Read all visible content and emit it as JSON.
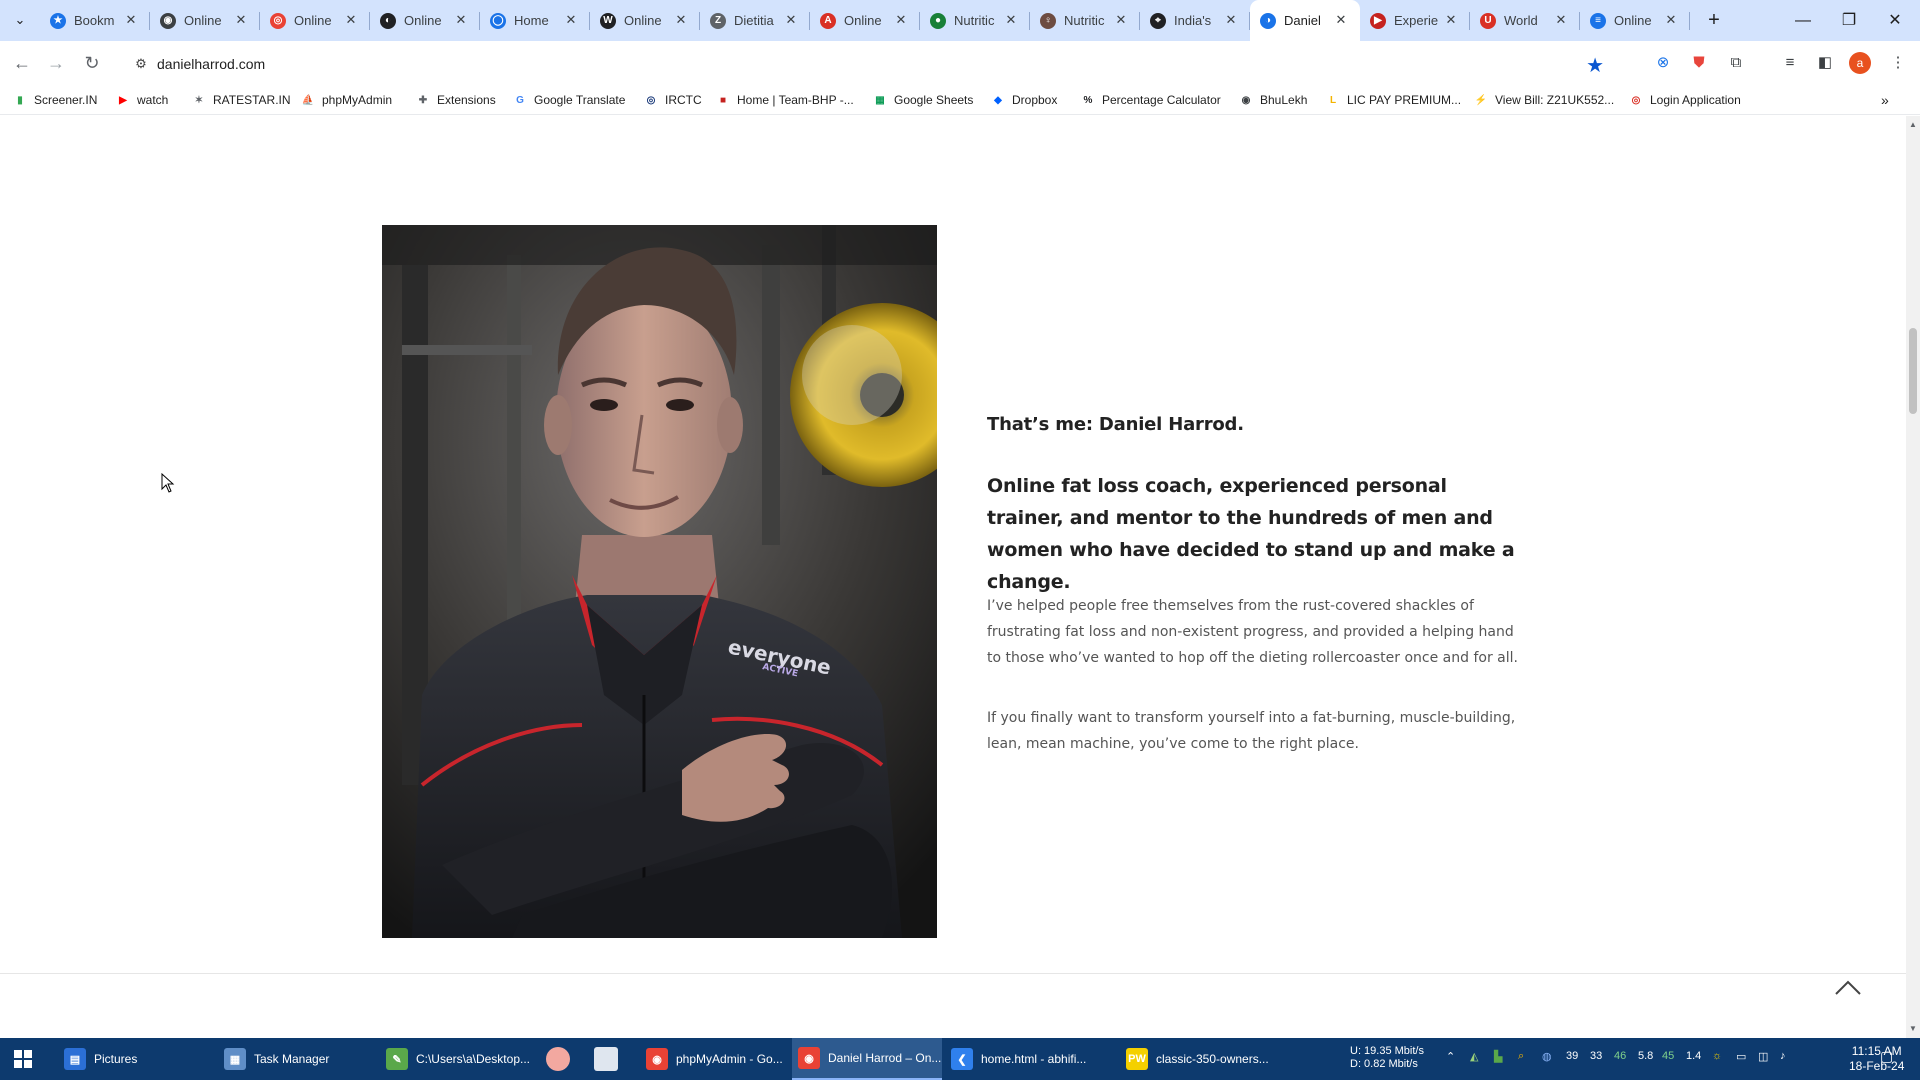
{
  "browser": {
    "tabs": [
      {
        "title": "Bookm",
        "fav_color": "#1a73e8",
        "fav_glyph": "★"
      },
      {
        "title": "Online",
        "fav_color": "#3c4043",
        "fav_glyph": "◉"
      },
      {
        "title": "Online",
        "fav_color": "#e94235",
        "fav_glyph": "◎"
      },
      {
        "title": "Online",
        "fav_color": "#202124",
        "fav_glyph": "◐"
      },
      {
        "title": "Home",
        "fav_color": "#1a73e8",
        "fav_glyph": "◯"
      },
      {
        "title": "Online",
        "fav_color": "#202124",
        "fav_glyph": "W"
      },
      {
        "title": "Dietitia",
        "fav_color": "#5f6368",
        "fav_glyph": "Z"
      },
      {
        "title": "Online",
        "fav_color": "#d93025",
        "fav_glyph": "A"
      },
      {
        "title": "Nutritic",
        "fav_color": "#188038",
        "fav_glyph": "●"
      },
      {
        "title": "Nutritic",
        "fav_color": "#6d4c41",
        "fav_glyph": "♀"
      },
      {
        "title": "India's",
        "fav_color": "#202124",
        "fav_glyph": "⌖"
      },
      {
        "title": "Daniel",
        "fav_color": "#1a73e8",
        "fav_glyph": "◑"
      },
      {
        "title": "Experie",
        "fav_color": "#c5221f",
        "fav_glyph": "▶"
      },
      {
        "title": "World",
        "fav_color": "#d93025",
        "fav_glyph": "U"
      },
      {
        "title": "Online",
        "fav_color": "#1a73e8",
        "fav_glyph": "≡"
      }
    ],
    "active_tab_index": 11,
    "url": "danielharrod.com"
  },
  "bookmarks": [
    {
      "label": "Screener.IN",
      "color": "#34a853",
      "glyph": "▮"
    },
    {
      "label": "watch",
      "color": "#ff0000",
      "glyph": "▶"
    },
    {
      "label": "RATESTAR.IN",
      "color": "#5f6368",
      "glyph": "✶"
    },
    {
      "label": "phpMyAdmin",
      "color": "#f29900",
      "glyph": "⛵"
    },
    {
      "label": "Extensions",
      "color": "#5f6368",
      "glyph": "✚"
    },
    {
      "label": "Google Translate",
      "color": "#4285f4",
      "glyph": "G"
    },
    {
      "label": "IRCTC",
      "color": "#1a3a7a",
      "glyph": "◎"
    },
    {
      "label": "Home | Team-BHP -...",
      "color": "#c5221f",
      "glyph": "■"
    },
    {
      "label": "Google Sheets",
      "color": "#0f9d58",
      "glyph": "▦"
    },
    {
      "label": "Dropbox",
      "color": "#0061ff",
      "glyph": "◆"
    },
    {
      "label": "Percentage Calculator",
      "color": "#202124",
      "glyph": "%"
    },
    {
      "label": "BhuLekh",
      "color": "#3c4043",
      "glyph": "◉"
    },
    {
      "label": "LIC PAY PREMIUM...",
      "color": "#f4b400",
      "glyph": "L"
    },
    {
      "label": "View Bill: Z21UK552...",
      "color": "#d93025",
      "glyph": "⚡"
    },
    {
      "label": "Login Application",
      "color": "#d93025",
      "glyph": "◎"
    }
  ],
  "content": {
    "heading": "That’s me: Daniel Harrod.",
    "subheading": "Online fat loss coach, experienced personal trainer, and mentor to the hundreds of men and women who have decided to stand up and make a change.",
    "para1": "I’ve helped people free themselves from the rust-covered shackles of frustrating fat loss and non-existent progress, and provided a helping hand to those who’ve wanted to hop off the dieting rollercoaster once and for all.",
    "para2": "If you finally want to transform yourself into a fat-burning, muscle-building, lean, mean machine, you’ve come to the right place.",
    "sleeve_text": "everyone",
    "sleeve_sub": "ACTIVE"
  },
  "taskbar": {
    "items": [
      {
        "label": "Pictures",
        "color": "#2b6fd6",
        "glyph": "▤"
      },
      {
        "label": "Task Manager",
        "color": "#5f8ec7",
        "glyph": "▦"
      },
      {
        "label": "C:\\Users\\a\\Desktop...",
        "color": "#5aa84a",
        "glyph": "✎"
      },
      {
        "label": "phpMyAdmin - Go...",
        "color": "#e94235",
        "glyph": "◉"
      },
      {
        "label": "Daniel Harrod – On...",
        "color": "#e94235",
        "glyph": "◉"
      },
      {
        "label": "home.html - abhifi...",
        "color": "#2f80ed",
        "glyph": "❮"
      },
      {
        "label": "classic-350-owners...",
        "color": "#f4d000",
        "glyph": "PW"
      }
    ],
    "active_index": 4,
    "net_up": "U:   19.35 Mbit/s",
    "net_down": "D:     0.82 Mbit/s",
    "tray_numbers": [
      "39",
      "33",
      "46",
      "5.8",
      "45",
      "1.4"
    ],
    "time": "11:15 AM",
    "date": "18-Feb-24"
  }
}
